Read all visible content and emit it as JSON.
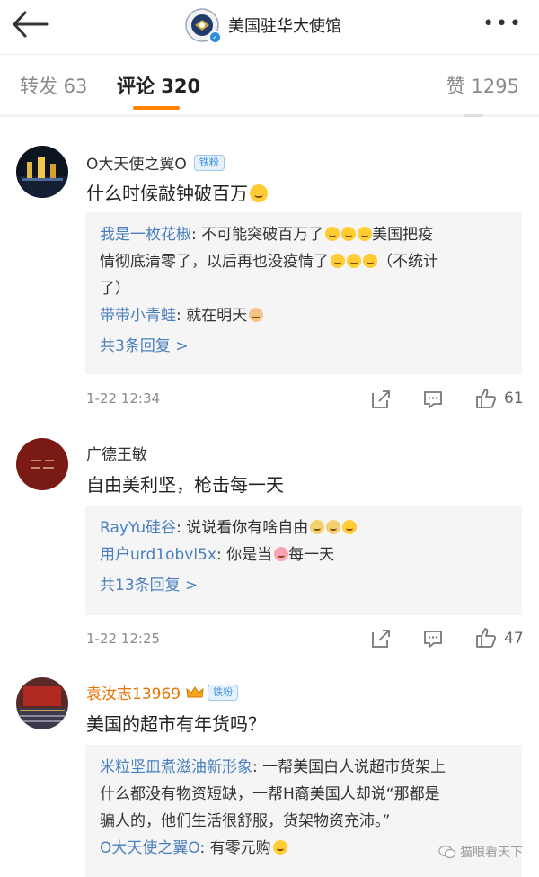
{
  "header": {
    "title": "美国驻华大使馆",
    "more_label": "•••"
  },
  "tabs": {
    "repost": "转发 63",
    "comments": "评论 320",
    "likes": "赞 1295"
  },
  "colors": {
    "accent": "#ff8200",
    "link": "#4a7fbf",
    "verified": "#2a8ce0"
  },
  "comments": [
    {
      "username": "O大天使之翼O",
      "badge": "铁粉",
      "text": "什么时候敲钟破百万",
      "replies": [
        {
          "name": "我是一枚花椒",
          "text_lines": [
            ": 不可能突破百万了",
            "美国把疫",
            "情彻底清零了，以后再也没疫情了",
            "（不统计",
            "了）"
          ]
        },
        {
          "name": "带带小青蛙",
          "text": ": 就在明天"
        }
      ],
      "more_replies": "共3条回复 >",
      "time": "1-22 12:34",
      "likes": "61"
    },
    {
      "username": "广德王敏",
      "text": "自由美利坚，枪击每一天",
      "replies": [
        {
          "name": "RayYu硅谷",
          "text": ": 说说看你有啥自由"
        },
        {
          "name": "用户urd1obvl5x",
          "text_a": ": 你是当",
          "text_b": "每一天"
        }
      ],
      "more_replies": "共13条回复 >",
      "time": "1-22 12:25",
      "likes": "47"
    },
    {
      "username": "袁汝志13969",
      "badge": "铁粉",
      "text": "美国的超市有年货吗？",
      "replies": [
        {
          "name": "米粒坚皿煮滋油新形象",
          "text_lines": [
            ": 一帮美国白人说超市货架上",
            "什么都没有物资短缺，一帮H裔美国人却说“那都是",
            "骗人的，他们生活很舒服，货架物资充沛。”"
          ]
        },
        {
          "name": "O大天使之翼O",
          "text": ": 有零元购"
        }
      ]
    }
  ],
  "watermark": "猫眼看天下"
}
